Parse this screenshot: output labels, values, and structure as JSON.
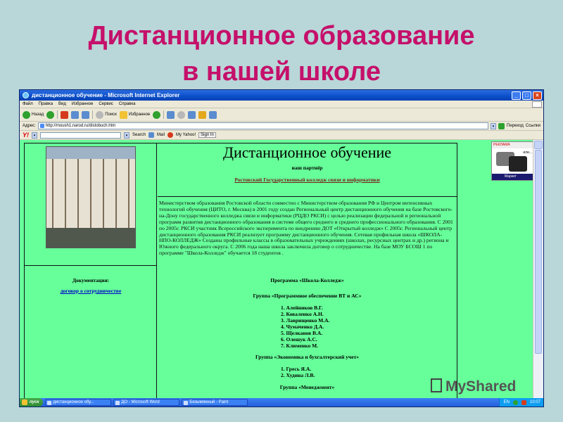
{
  "slide": {
    "title_line1": "Дистанционное образование",
    "title_line2": "в нашей школе",
    "title_color": "#c5106a",
    "background_color": "#b9d6d9"
  },
  "browser": {
    "window_title": "дистанционное обучение - Microsoft Internet Explorer",
    "menu": [
      "Файл",
      "Правка",
      "Вид",
      "Избранное",
      "Сервис",
      "Справка"
    ],
    "toolbar": {
      "back": "Назад",
      "search": "Поиск",
      "favorites": "Избранное"
    },
    "address_label": "Адрес:",
    "address_url": "http://moush1.narod.ru/distobuch.htm",
    "go_label": "Переход",
    "links_label": "Ссылки",
    "yahoo": {
      "logo": "Y!",
      "search_btn": "Search",
      "mail": "Mail",
      "my_yahoo": "My Yahoo!",
      "sign_in": "Sign In"
    }
  },
  "page": {
    "heading": "Дистанционное обучение",
    "partner_label": "наш партнёр",
    "partner_link": "Ростовский Государственный колледж связи и информатики",
    "paragraph": "Министерством образования Ростовской области совместно с Министерством образования РФ и Центром интенсивных технологий обучения (ЦИТО, г. Москва) в 2001 году создан Региональный центр дистанционного обучения на базе Ростовского-на-Дону государственного колледжа связи и информатики (РЦДО РКСИ) с целью реализации федеральной и региональной программ развития дистанционного образования в системе общего среднего и среднего профессионального образования. С 2001 по 2005г. РКСИ участник Всероссийского эксперимента по внедрению ДОТ «Открытый колледж» С 2005г. Региональный центр дистанционного образования РКСИ реализует программу дистанционного обучения. Сетевая профильная школа «ШКОЛА-НПО-КОЛЛЕДЖ» Созданы профильные классы в образовательных учреждениях (школах, ресурсных центрах и др.) региона и Южного федерального округа. С 2006 года наша школа заключила договор о сотрудничестве. На базе МОУ БСОШ 1 по программе \"Школа-Колледж\" обучается 18 студентов .",
    "doc_label": "Документация:",
    "doc_link": "договор о сотрудничестве",
    "program_title": "Программа «Школа-Колледж»",
    "group1_title": "Группа «Программное обеспечение ВТ и АС»",
    "group1_students": [
      "1.   Алейников В.Г.",
      "2.   Коваленко А.Н.",
      "3.   Лаврищенко М.А.",
      "4.   Чумаченко Д.А.",
      "5.   Щелканов В.А.",
      "6.   Олешук А.С.",
      "7.   Клименко М."
    ],
    "group2_title": "Группа «Экономика и бухгалтерский учет»",
    "group2_students": [
      "1.   Гресь Я.А.",
      "2.   Худина Л.В."
    ],
    "group3_title": "Группа «Менеджмент»",
    "content_bg": "#66ff99"
  },
  "ad": {
    "head": "РЕКЛАМА",
    "text": "или...",
    "foot": "Маркет"
  },
  "taskbar": {
    "start": "пуск",
    "tasks": [
      "дистанционное обу...",
      "ДО - Microsoft Word",
      "Безымянный - Paint"
    ],
    "lang": "EN",
    "time": "10:07"
  },
  "watermark": "MyShared"
}
